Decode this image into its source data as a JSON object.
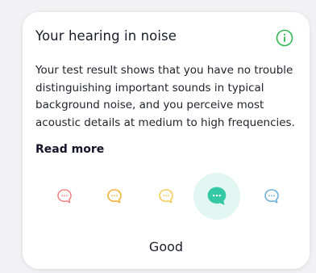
{
  "card": {
    "title": "Your hearing in noise",
    "description": "Your test result shows that you have no trouble distinguishing important sounds in typical background noise, and you perceive most acoustic details at medium to high frequencies.",
    "read_more": "Read more",
    "info_icon": "info-icon",
    "colors": {
      "accent": "#3cc9a6",
      "info": "#2fb84f",
      "title": "#1c1c2a"
    }
  },
  "rating": {
    "label": "Good",
    "selected_index": 3,
    "icon": "speech-bubble-icon",
    "levels": [
      {
        "color": "#ee8a86"
      },
      {
        "color": "#f2b23a"
      },
      {
        "color": "#f3cc5a"
      },
      {
        "color": "#34c9a4"
      },
      {
        "color": "#6fb0d8"
      }
    ]
  }
}
